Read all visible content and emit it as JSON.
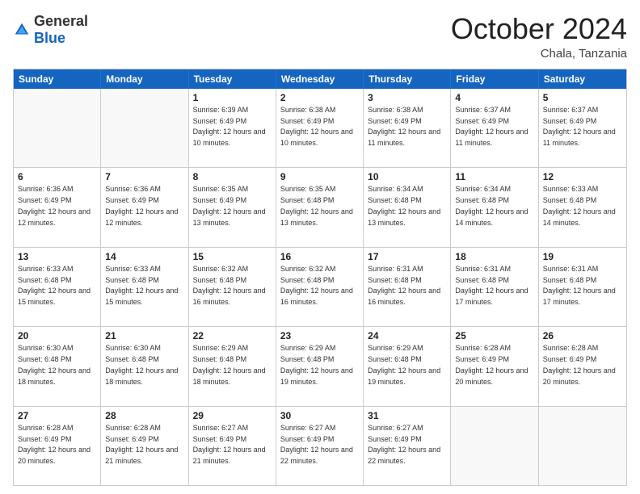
{
  "header": {
    "logo_general": "General",
    "logo_blue": "Blue",
    "month_title": "October 2024",
    "location": "Chala, Tanzania"
  },
  "days_of_week": [
    "Sunday",
    "Monday",
    "Tuesday",
    "Wednesday",
    "Thursday",
    "Friday",
    "Saturday"
  ],
  "weeks": [
    [
      {
        "day": "",
        "sunrise": "",
        "sunset": "",
        "daylight": "",
        "empty": true
      },
      {
        "day": "",
        "sunrise": "",
        "sunset": "",
        "daylight": "",
        "empty": true
      },
      {
        "day": "1",
        "sunrise": "Sunrise: 6:39 AM",
        "sunset": "Sunset: 6:49 PM",
        "daylight": "Daylight: 12 hours and 10 minutes.",
        "empty": false
      },
      {
        "day": "2",
        "sunrise": "Sunrise: 6:38 AM",
        "sunset": "Sunset: 6:49 PM",
        "daylight": "Daylight: 12 hours and 10 minutes.",
        "empty": false
      },
      {
        "day": "3",
        "sunrise": "Sunrise: 6:38 AM",
        "sunset": "Sunset: 6:49 PM",
        "daylight": "Daylight: 12 hours and 11 minutes.",
        "empty": false
      },
      {
        "day": "4",
        "sunrise": "Sunrise: 6:37 AM",
        "sunset": "Sunset: 6:49 PM",
        "daylight": "Daylight: 12 hours and 11 minutes.",
        "empty": false
      },
      {
        "day": "5",
        "sunrise": "Sunrise: 6:37 AM",
        "sunset": "Sunset: 6:49 PM",
        "daylight": "Daylight: 12 hours and 11 minutes.",
        "empty": false
      }
    ],
    [
      {
        "day": "6",
        "sunrise": "Sunrise: 6:36 AM",
        "sunset": "Sunset: 6:49 PM",
        "daylight": "Daylight: 12 hours and 12 minutes.",
        "empty": false
      },
      {
        "day": "7",
        "sunrise": "Sunrise: 6:36 AM",
        "sunset": "Sunset: 6:49 PM",
        "daylight": "Daylight: 12 hours and 12 minutes.",
        "empty": false
      },
      {
        "day": "8",
        "sunrise": "Sunrise: 6:35 AM",
        "sunset": "Sunset: 6:49 PM",
        "daylight": "Daylight: 12 hours and 13 minutes.",
        "empty": false
      },
      {
        "day": "9",
        "sunrise": "Sunrise: 6:35 AM",
        "sunset": "Sunset: 6:48 PM",
        "daylight": "Daylight: 12 hours and 13 minutes.",
        "empty": false
      },
      {
        "day": "10",
        "sunrise": "Sunrise: 6:34 AM",
        "sunset": "Sunset: 6:48 PM",
        "daylight": "Daylight: 12 hours and 13 minutes.",
        "empty": false
      },
      {
        "day": "11",
        "sunrise": "Sunrise: 6:34 AM",
        "sunset": "Sunset: 6:48 PM",
        "daylight": "Daylight: 12 hours and 14 minutes.",
        "empty": false
      },
      {
        "day": "12",
        "sunrise": "Sunrise: 6:33 AM",
        "sunset": "Sunset: 6:48 PM",
        "daylight": "Daylight: 12 hours and 14 minutes.",
        "empty": false
      }
    ],
    [
      {
        "day": "13",
        "sunrise": "Sunrise: 6:33 AM",
        "sunset": "Sunset: 6:48 PM",
        "daylight": "Daylight: 12 hours and 15 minutes.",
        "empty": false
      },
      {
        "day": "14",
        "sunrise": "Sunrise: 6:33 AM",
        "sunset": "Sunset: 6:48 PM",
        "daylight": "Daylight: 12 hours and 15 minutes.",
        "empty": false
      },
      {
        "day": "15",
        "sunrise": "Sunrise: 6:32 AM",
        "sunset": "Sunset: 6:48 PM",
        "daylight": "Daylight: 12 hours and 16 minutes.",
        "empty": false
      },
      {
        "day": "16",
        "sunrise": "Sunrise: 6:32 AM",
        "sunset": "Sunset: 6:48 PM",
        "daylight": "Daylight: 12 hours and 16 minutes.",
        "empty": false
      },
      {
        "day": "17",
        "sunrise": "Sunrise: 6:31 AM",
        "sunset": "Sunset: 6:48 PM",
        "daylight": "Daylight: 12 hours and 16 minutes.",
        "empty": false
      },
      {
        "day": "18",
        "sunrise": "Sunrise: 6:31 AM",
        "sunset": "Sunset: 6:48 PM",
        "daylight": "Daylight: 12 hours and 17 minutes.",
        "empty": false
      },
      {
        "day": "19",
        "sunrise": "Sunrise: 6:31 AM",
        "sunset": "Sunset: 6:48 PM",
        "daylight": "Daylight: 12 hours and 17 minutes.",
        "empty": false
      }
    ],
    [
      {
        "day": "20",
        "sunrise": "Sunrise: 6:30 AM",
        "sunset": "Sunset: 6:48 PM",
        "daylight": "Daylight: 12 hours and 18 minutes.",
        "empty": false
      },
      {
        "day": "21",
        "sunrise": "Sunrise: 6:30 AM",
        "sunset": "Sunset: 6:48 PM",
        "daylight": "Daylight: 12 hours and 18 minutes.",
        "empty": false
      },
      {
        "day": "22",
        "sunrise": "Sunrise: 6:29 AM",
        "sunset": "Sunset: 6:48 PM",
        "daylight": "Daylight: 12 hours and 18 minutes.",
        "empty": false
      },
      {
        "day": "23",
        "sunrise": "Sunrise: 6:29 AM",
        "sunset": "Sunset: 6:48 PM",
        "daylight": "Daylight: 12 hours and 19 minutes.",
        "empty": false
      },
      {
        "day": "24",
        "sunrise": "Sunrise: 6:29 AM",
        "sunset": "Sunset: 6:48 PM",
        "daylight": "Daylight: 12 hours and 19 minutes.",
        "empty": false
      },
      {
        "day": "25",
        "sunrise": "Sunrise: 6:28 AM",
        "sunset": "Sunset: 6:49 PM",
        "daylight": "Daylight: 12 hours and 20 minutes.",
        "empty": false
      },
      {
        "day": "26",
        "sunrise": "Sunrise: 6:28 AM",
        "sunset": "Sunset: 6:49 PM",
        "daylight": "Daylight: 12 hours and 20 minutes.",
        "empty": false
      }
    ],
    [
      {
        "day": "27",
        "sunrise": "Sunrise: 6:28 AM",
        "sunset": "Sunset: 6:49 PM",
        "daylight": "Daylight: 12 hours and 20 minutes.",
        "empty": false
      },
      {
        "day": "28",
        "sunrise": "Sunrise: 6:28 AM",
        "sunset": "Sunset: 6:49 PM",
        "daylight": "Daylight: 12 hours and 21 minutes.",
        "empty": false
      },
      {
        "day": "29",
        "sunrise": "Sunrise: 6:27 AM",
        "sunset": "Sunset: 6:49 PM",
        "daylight": "Daylight: 12 hours and 21 minutes.",
        "empty": false
      },
      {
        "day": "30",
        "sunrise": "Sunrise: 6:27 AM",
        "sunset": "Sunset: 6:49 PM",
        "daylight": "Daylight: 12 hours and 22 minutes.",
        "empty": false
      },
      {
        "day": "31",
        "sunrise": "Sunrise: 6:27 AM",
        "sunset": "Sunset: 6:49 PM",
        "daylight": "Daylight: 12 hours and 22 minutes.",
        "empty": false
      },
      {
        "day": "",
        "sunrise": "",
        "sunset": "",
        "daylight": "",
        "empty": true
      },
      {
        "day": "",
        "sunrise": "",
        "sunset": "",
        "daylight": "",
        "empty": true
      }
    ]
  ]
}
